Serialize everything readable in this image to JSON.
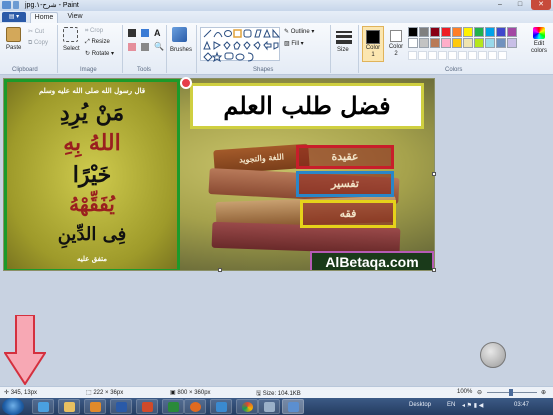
{
  "window": {
    "title": "‫شرح-١.jpg‬ - Paint"
  },
  "title_bar": {
    "minimize": "–",
    "maximize": "□",
    "close": "✕"
  },
  "menu": {
    "file": "▤ ▾",
    "tabs": [
      "Home",
      "View"
    ]
  },
  "ribbon": {
    "clipboard": {
      "paste": "Paste",
      "cut": "Cut",
      "copy": "Copy",
      "label": "Clipboard"
    },
    "image": {
      "select": "Select",
      "crop": "Crop",
      "resize": "Resize",
      "rotate": "Rotate ▾",
      "label": "Image"
    },
    "tools": {
      "label": "Tools"
    },
    "brushes": {
      "label": "Brushes"
    },
    "shapes": {
      "outline": "Outline ▾",
      "fill": "Fill ▾",
      "label": "Shapes"
    },
    "size": {
      "label": "Size"
    },
    "color1": {
      "label": "Color\n1"
    },
    "color2": {
      "label": "Color\n2"
    },
    "colors": {
      "label": "Colors",
      "edit": "Edit\ncolors"
    },
    "palette": [
      "#000000",
      "#7f7f7f",
      "#880015",
      "#ed1c24",
      "#ff7f27",
      "#fff200",
      "#22b14c",
      "#00a2e8",
      "#3f48cc",
      "#a349a4",
      "#ffffff",
      "#c3c3c3",
      "#b97a57",
      "#ffaec9",
      "#ffc90e",
      "#efe4b0",
      "#b5e61d",
      "#99d9ea",
      "#7092be",
      "#c8bfe7"
    ]
  },
  "image": {
    "left_panel": {
      "header": "قال رسول الله صلى الله عليه وسلم",
      "line1": "مَنْ يُرِدِ",
      "line2": "اللهُ بِهِ",
      "line3": "خَيْرًا",
      "line4": "يُفَقِّهْهُ",
      "line5": "فِى الدِّينِ",
      "footer": "متفق عليه"
    },
    "title": "فضل طلب العلم",
    "book_labels": [
      "عقيدة",
      "تفسير",
      "فقه"
    ],
    "top_book_label": "اللغة والتجويد",
    "brand": "AlBetaqa.com"
  },
  "status_bar": {
    "cursor": "345, 13px",
    "selection": "222 × 36px",
    "image_size": "800 × 360px",
    "file_size": "Size: 104.1KB",
    "zoom": "100%"
  },
  "taskbar": {
    "language": "Desktop",
    "locale": "EN",
    "time": "03:47"
  }
}
